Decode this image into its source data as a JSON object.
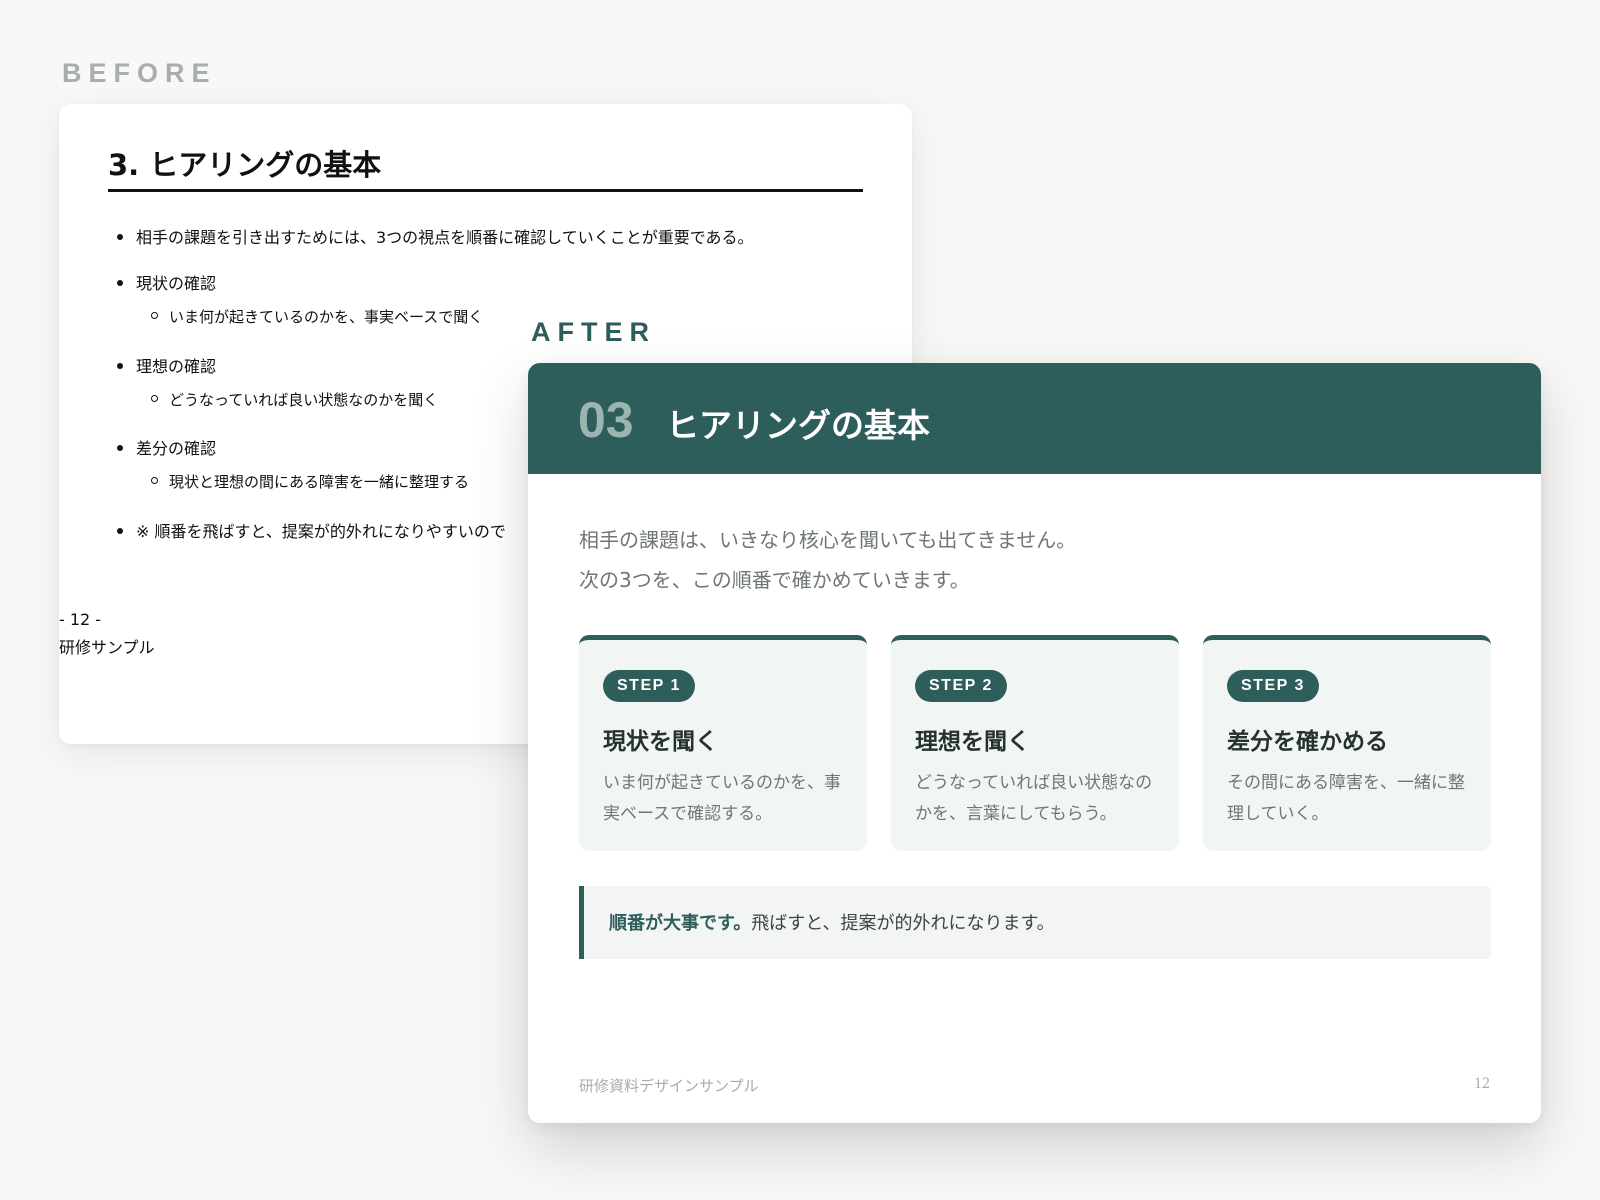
{
  "labels": {
    "before": "BEFORE",
    "after": "AFTER"
  },
  "before": {
    "title": "3. ヒアリングの基本",
    "bullets": [
      {
        "text": "相手の課題を引き出すためには、3つの視点を順番に確認していくことが重要である。"
      },
      {
        "text": "現状の確認",
        "sub": "いま何が起きているのかを、事実ベースで聞く"
      },
      {
        "text": "理想の確認",
        "sub": "どうなっていれば良い状態なのかを聞く"
      },
      {
        "text": "差分の確認",
        "sub": "現状と理想の間にある障害を一緒に整理する"
      },
      {
        "text": "※ 順番を飛ばすと、提案が的外れになりやすいので"
      }
    ],
    "page": "- 12 -",
    "footer": "研修サンプル"
  },
  "after": {
    "number": "03",
    "title": "ヒアリングの基本",
    "intro": [
      "相手の課題は、いきなり核心を聞いても出てきません。",
      "次の3つを、この順番で確かめていきます。"
    ],
    "steps": [
      {
        "badge": "STEP 1",
        "title": "現状を聞く",
        "desc": "いま何が起きているのかを、事実ベースで確認する。"
      },
      {
        "badge": "STEP 2",
        "title": "理想を聞く",
        "desc": "どうなっていれば良い状態なのかを、言葉にしてもらう。"
      },
      {
        "badge": "STEP 3",
        "title": "差分を確かめる",
        "desc": "その間にある障害を、一緒に整理していく。"
      }
    ],
    "callout": {
      "emphasis": "順番が大事です。",
      "text": "飛ばすと、提案が的外れになります。"
    },
    "footer": "研修資料デザインサンプル",
    "page": "12"
  },
  "colors": {
    "accent": "#2e5e5c",
    "accent_light": "#9bb5b3",
    "card_bg": "#f1f5f4",
    "background": "#f8f8f6"
  }
}
